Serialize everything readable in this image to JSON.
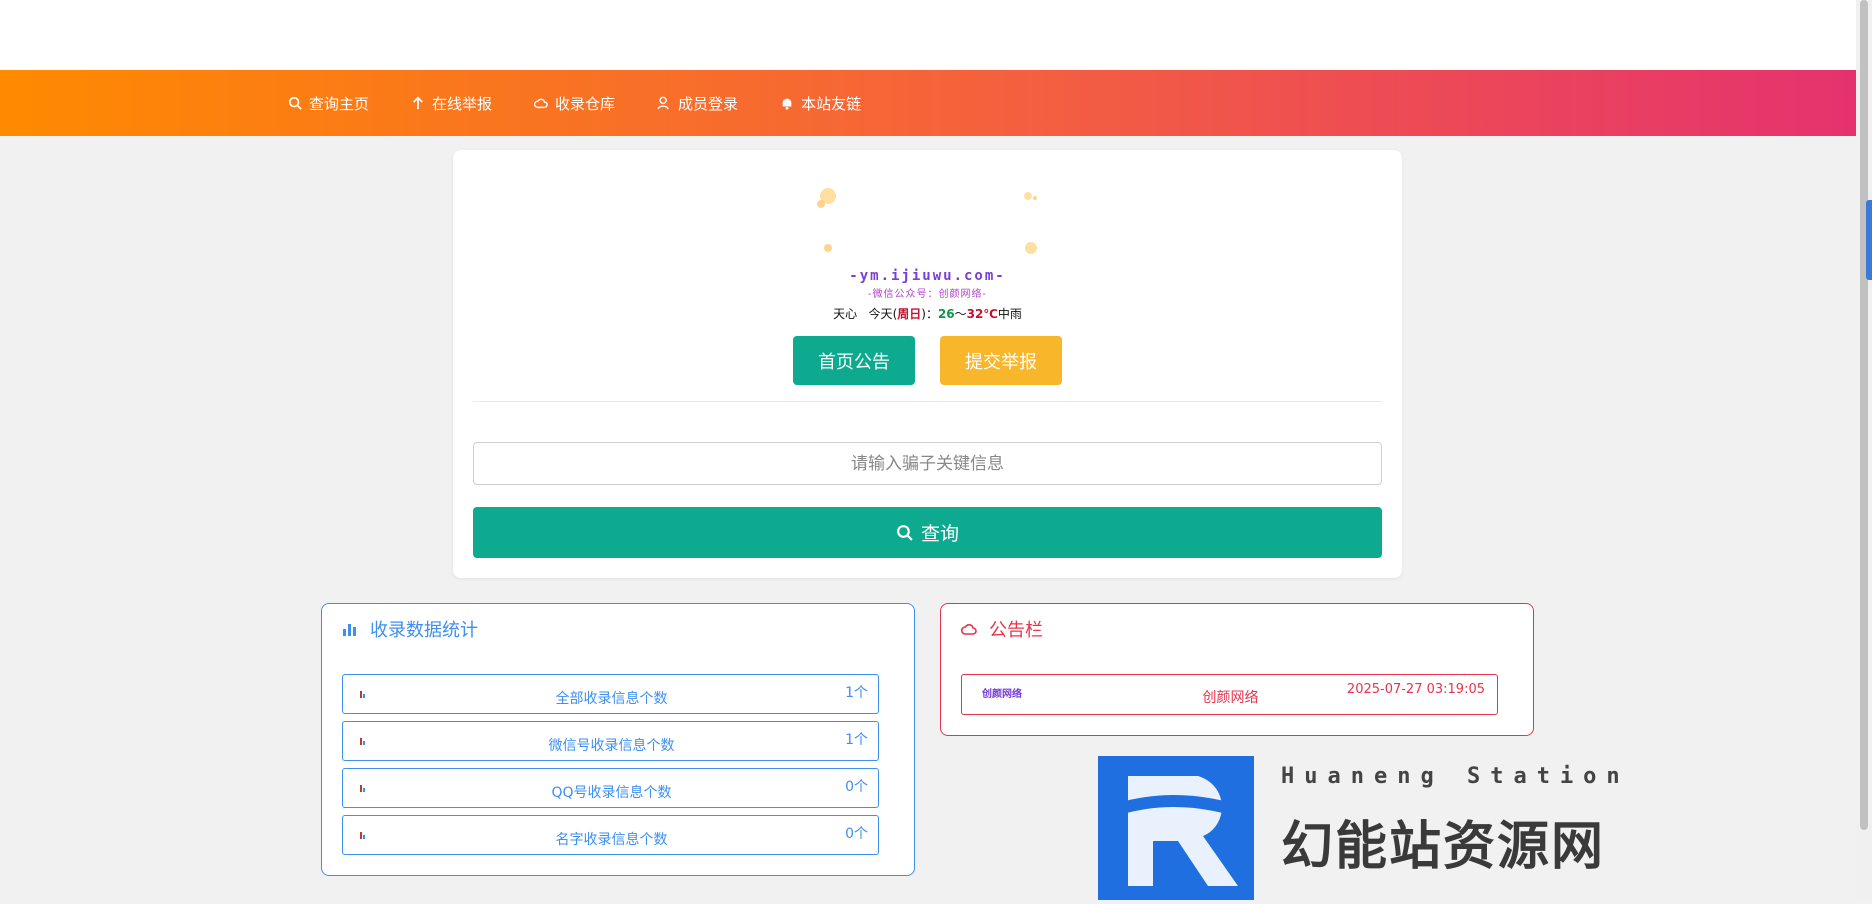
{
  "nav": {
    "items": [
      {
        "label": "查询主页",
        "icon": "search-icon"
      },
      {
        "label": "在线举报",
        "icon": "arrow-up-icon"
      },
      {
        "label": "收录仓库",
        "icon": "cloud-icon"
      },
      {
        "label": "成员登录",
        "icon": "user-icon"
      },
      {
        "label": "本站友链",
        "icon": "bell-icon"
      }
    ]
  },
  "logo": {
    "url_text": "-ym.ijiuwu.com-",
    "subtitle": "-微信公众号：创颜网络-"
  },
  "weather": {
    "city": "天心",
    "today": "今天",
    "day_open": "(",
    "day_name": "周日",
    "day_close": ")：",
    "low": "26",
    "sep": "～",
    "high": "32℃",
    "condition": "中雨"
  },
  "buttons": {
    "notice": "首页公告",
    "report": "提交举报"
  },
  "search": {
    "placeholder": "请输入骗子关键信息",
    "button_label": "查询"
  },
  "stats": {
    "title": "收录数据统计",
    "rows": [
      {
        "label": "全部收录信息个数",
        "count": "1个"
      },
      {
        "label": "微信号收录信息个数",
        "count": "1个"
      },
      {
        "label": "QQ号收录信息个数",
        "count": "0个"
      },
      {
        "label": "名字收录信息个数",
        "count": "0个"
      }
    ]
  },
  "notice": {
    "title": "公告栏",
    "items": [
      {
        "logo_text": "创颜网络",
        "name": "创颜网络",
        "time": "2025-07-27 03:19:05"
      }
    ]
  },
  "brand": {
    "en": "Huaneng Station",
    "cn": "幻能站资源网"
  },
  "colors": {
    "nav_start": "#ff8a00",
    "nav_end": "#e5326f",
    "primary_green": "#0eaa8f",
    "warning_yellow": "#f8b62b",
    "stats_blue": "#3d8ff2",
    "notice_red": "#e8334d"
  }
}
